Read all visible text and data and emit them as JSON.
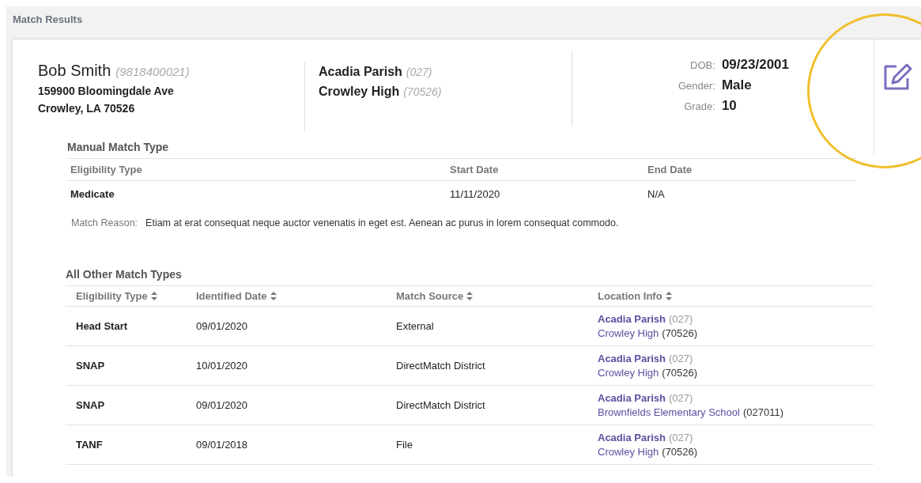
{
  "panel": {
    "title": "Match Results"
  },
  "student": {
    "name": "Bob Smith",
    "id": "(9818400021)",
    "address_line1": "159900 Bloomingdale Ave",
    "address_line2": "Crowley, LA 70526"
  },
  "school_info": [
    {
      "name": "Acadia Parish",
      "code": "(027)"
    },
    {
      "name": "Crowley High",
      "code": "(70526)"
    }
  ],
  "details": [
    {
      "label": "DOB:",
      "value": "09/23/2001"
    },
    {
      "label": "Gender:",
      "value": "Male"
    },
    {
      "label": "Grade:",
      "value": "10"
    }
  ],
  "manual_match": {
    "title": "Manual Match Type",
    "columns": [
      "Eligibility Type",
      "Start Date",
      "End Date"
    ],
    "row": [
      "Medicate",
      "11/11/2020",
      "N/A"
    ],
    "reason_label": "Match Reason:",
    "reason": "Etiam at erat consequat neque auctor venenatis in eget est. Aenean ac purus in lorem consequat commodo."
  },
  "other_matches": {
    "title": "All Other Match Types",
    "columns": [
      "Eligibility Type",
      "Identified Date",
      "Match Source",
      "Location Info"
    ],
    "rows": [
      {
        "eligibility": "Head Start",
        "date": "09/01/2020",
        "source": "External",
        "parish": "Acadia Parish",
        "parish_code": "(027)",
        "school": "Crowley High",
        "school_code": "(70526)"
      },
      {
        "eligibility": "SNAP",
        "date": "10/01/2020",
        "source": "DirectMatch District",
        "parish": "Acadia Parish",
        "parish_code": "(027)",
        "school": "Crowley High",
        "school_code": "(70526)"
      },
      {
        "eligibility": "SNAP",
        "date": "09/01/2020",
        "source": "DirectMatch District",
        "parish": "Acadia Parish",
        "parish_code": "(027)",
        "school": "Brownfields Elementary School",
        "school_code": "(027011)"
      },
      {
        "eligibility": "TANF",
        "date": "09/01/2018",
        "source": "File",
        "parish": "Acadia Parish",
        "parish_code": "(027)",
        "school": "Crowley High",
        "school_code": "(70526)"
      }
    ]
  }
}
